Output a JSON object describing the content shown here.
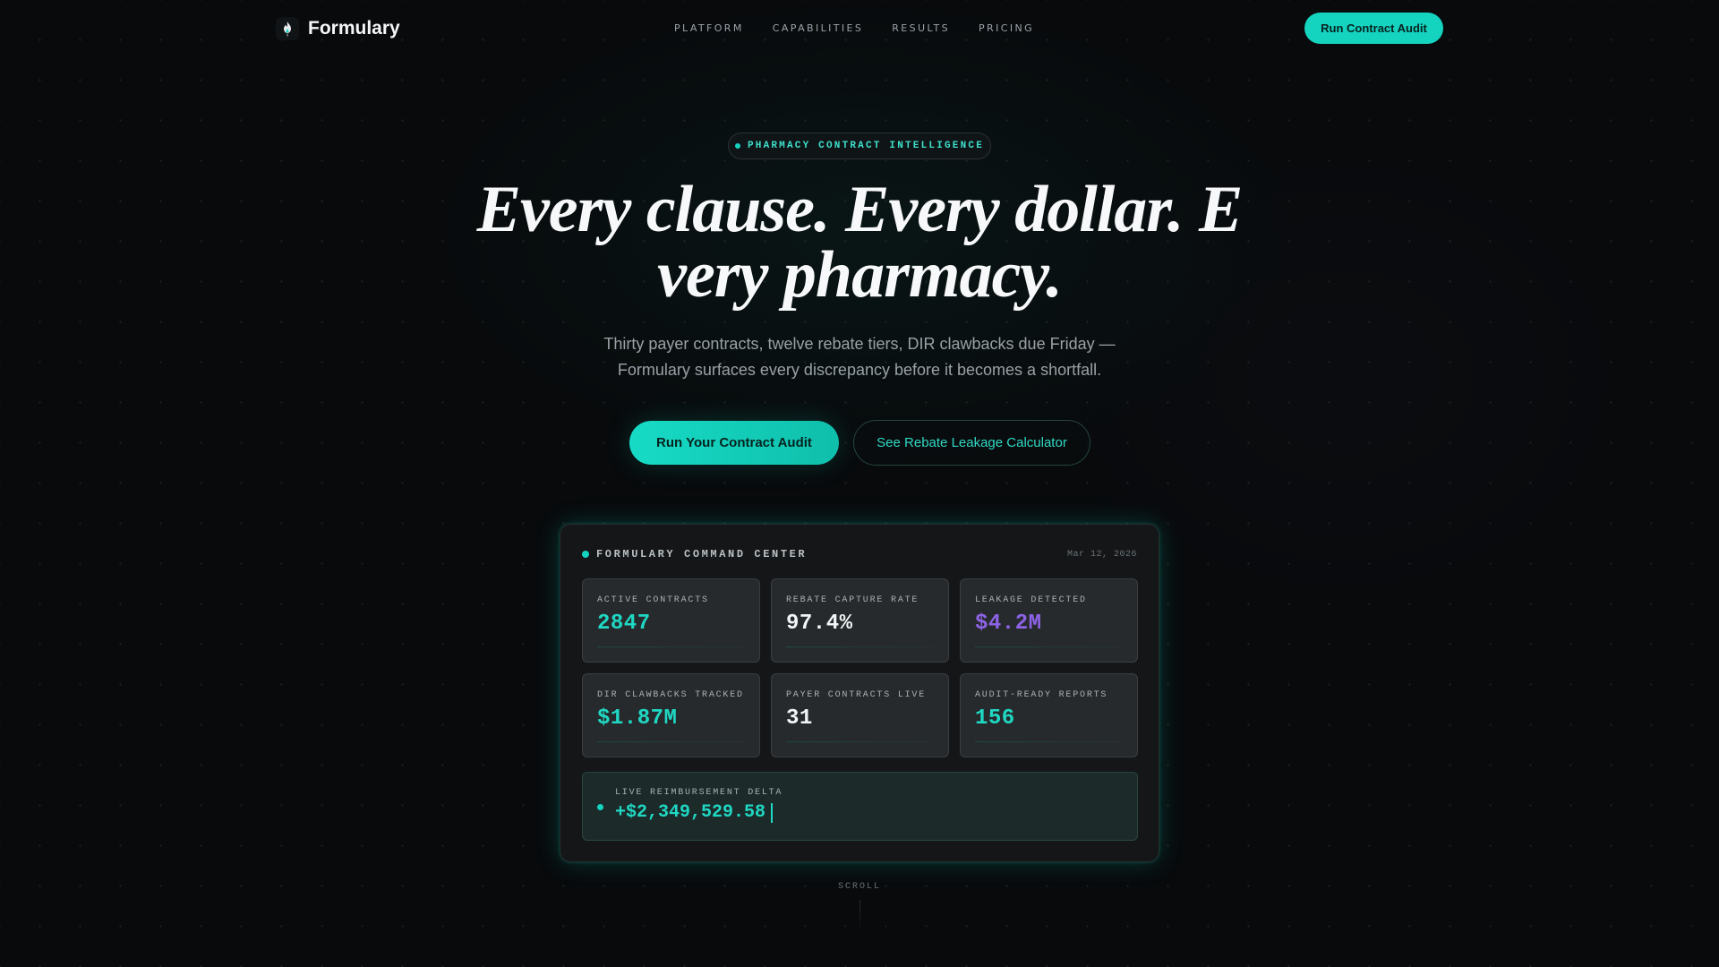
{
  "brand": {
    "name": "Formulary",
    "logo_icon": "flame-icon"
  },
  "nav": {
    "links": [
      "PLATFORM",
      "CAPABILITIES",
      "RESULTS",
      "PRICING"
    ],
    "cta_label": "Run Contract Audit"
  },
  "hero": {
    "eyebrow": "PHARMACY CONTRACT INTELLIGENCE",
    "headline": "Every clause. Every dollar. Every pharmacy.",
    "subhead": "Thirty payer contracts, twelve rebate tiers, DIR clawbacks due Friday — Formulary surfaces every discrepancy before it becomes a shortfall.",
    "primary_cta": "Run Your Contract Audit",
    "secondary_cta": "See Rebate Leakage Calculator"
  },
  "dashboard": {
    "title": "FORMULARY COMMAND CENTER",
    "date": "Mar 12, 2026",
    "metrics": [
      {
        "label": "ACTIVE CONTRACTS",
        "value": "2847",
        "tone": "teal"
      },
      {
        "label": "REBATE CAPTURE RATE",
        "value": "97.4%",
        "tone": "white"
      },
      {
        "label": "LEAKAGE DETECTED",
        "value": "$4.2M",
        "tone": "purple"
      },
      {
        "label": "DIR CLAWBACKS TRACKED",
        "value": "$1.87M",
        "tone": "teal"
      },
      {
        "label": "PAYER CONTRACTS LIVE",
        "value": "31",
        "tone": "white"
      },
      {
        "label": "AUDIT-READY REPORTS",
        "value": "156",
        "tone": "teal"
      }
    ],
    "delta": {
      "label": "LIVE REIMBURSEMENT DELTA",
      "value": "+$2,349,529.58"
    }
  },
  "scroll_label": "SCROLL",
  "colors": {
    "accent": "#14d3bf",
    "background": "#080a0c",
    "purple": "#8d63e6"
  }
}
